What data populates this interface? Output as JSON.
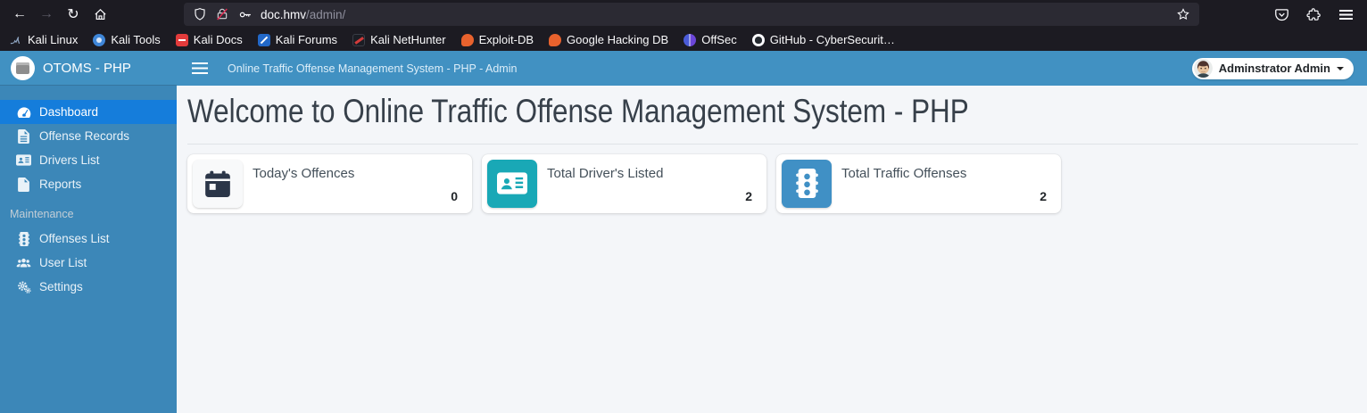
{
  "chrome": {
    "url": {
      "host": "doc.hmv",
      "path": "/admin/"
    },
    "bookmarks": [
      {
        "label": "Kali Linux",
        "icon": "kali-linux-favicon"
      },
      {
        "label": "Kali Tools",
        "icon": "kali-tools-favicon"
      },
      {
        "label": "Kali Docs",
        "icon": "kali-docs-favicon"
      },
      {
        "label": "Kali Forums",
        "icon": "kali-forums-favicon"
      },
      {
        "label": "Kali NetHunter",
        "icon": "kali-nethunter-favicon"
      },
      {
        "label": "Exploit-DB",
        "icon": "exploit-db-favicon"
      },
      {
        "label": "Google Hacking DB",
        "icon": "google-hacking-db-favicon"
      },
      {
        "label": "OffSec",
        "icon": "offsec-favicon"
      },
      {
        "label": "GitHub - CyberSecurit…",
        "icon": "github-favicon"
      }
    ],
    "toolbar_icons": {
      "back": "←",
      "forward": "→",
      "reload": "↻",
      "star": "☆"
    }
  },
  "app": {
    "brand": "OTOMS - PHP",
    "navbar_title": "Online Traffic Offense Management System - PHP - Admin",
    "user_menu_label": "Adminstrator Admin",
    "sidebar": {
      "items": [
        {
          "label": "Dashboard",
          "icon": "tachometer-icon",
          "active": true
        },
        {
          "label": "Offense Records",
          "icon": "file-alt-icon",
          "active": false
        },
        {
          "label": "Drivers List",
          "icon": "id-card-icon",
          "active": false
        },
        {
          "label": "Reports",
          "icon": "file-icon",
          "active": false
        }
      ],
      "section_label": "Maintenance",
      "section_items": [
        {
          "label": "Offenses List",
          "icon": "traffic-light-icon",
          "active": false
        },
        {
          "label": "User List",
          "icon": "users-icon",
          "active": false
        },
        {
          "label": "Settings",
          "icon": "cogs-icon",
          "active": false
        }
      ]
    },
    "main": {
      "heading": "Welcome to Online Traffic Offense Management System - PHP",
      "cards": [
        {
          "label": "Today's Offences",
          "value": "0",
          "icon": "calendar-icon",
          "icon_bg": "#f8f9fa"
        },
        {
          "label": "Total Driver's Listed",
          "value": "2",
          "icon": "id-card-icon",
          "icon_bg": "#19a8b6"
        },
        {
          "label": "Total Traffic Offenses",
          "value": "2",
          "icon": "traffic-light-icon",
          "icon_bg": "#4090c5"
        }
      ]
    }
  },
  "colors": {
    "chrome_bg": "#1c1b22",
    "urlbar_bg": "#2b2a33",
    "navbar_blue": "#4191c2",
    "sidebar_blue": "#3c87b8",
    "active_item_blue": "#157ddb",
    "teal_accent": "#19a8b6",
    "card_icon_blue": "#4090c5",
    "page_bg": "#f4f6f9",
    "insecure_red": "#e22850"
  }
}
